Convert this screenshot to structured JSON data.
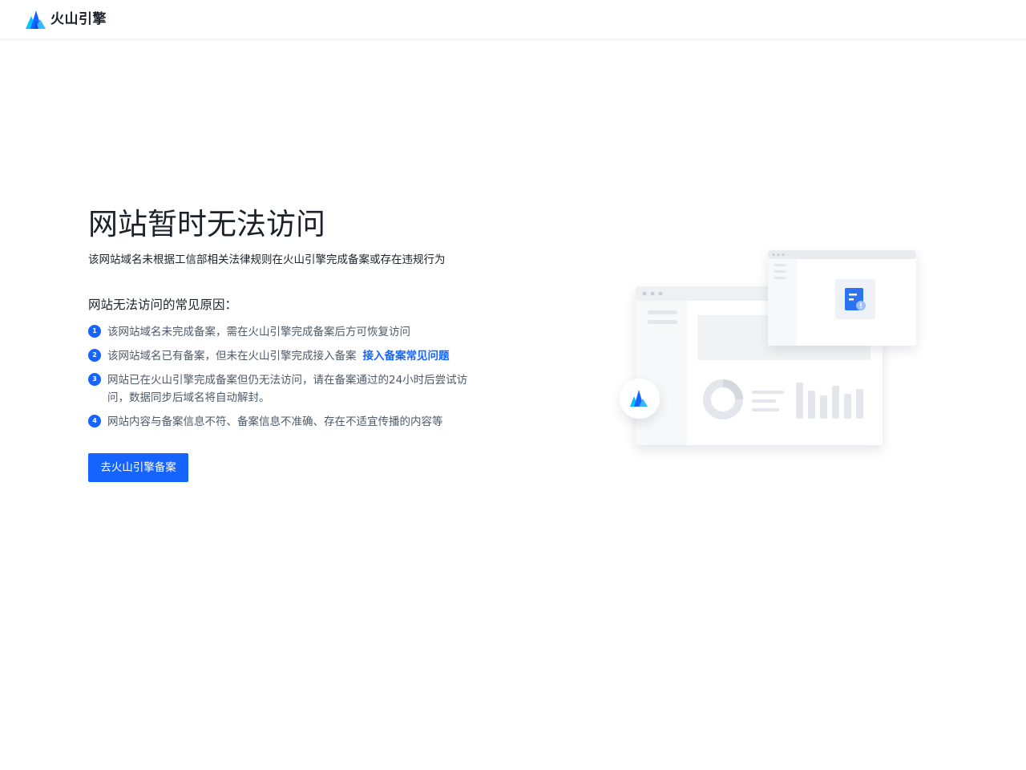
{
  "header": {
    "brand_name": "火山引擎",
    "logo_icon": "volcengine-logo-icon"
  },
  "main": {
    "title": "网站暂时无法访问",
    "subtitle": "该网站域名未根据工信部相关法律规则在火山引擎完成备案或存在违规行为",
    "reasons_heading": "网站无法访问的常见原因：",
    "reasons": [
      {
        "num": "1",
        "text": "该网站域名未完成备案，需在火山引擎完成备案后方可恢复访问"
      },
      {
        "num": "2",
        "text": "该网站域名已有备案，但未在火山引擎完成接入备案",
        "link": "接入备案常见问题"
      },
      {
        "num": "3",
        "text": "网站已在火山引擎完成备案但仍无法访问，请在备案通过的24小时后尝试访问，数据同步后域名将自动解封。"
      },
      {
        "num": "4",
        "text": "网站内容与备案信息不符、备案信息不准确、存在不适宜传播的内容等"
      }
    ],
    "cta_label": "去火山引擎备案"
  },
  "colors": {
    "accent": "#1664ff",
    "text_primary": "#1d2129",
    "text_secondary": "#4e5969"
  }
}
